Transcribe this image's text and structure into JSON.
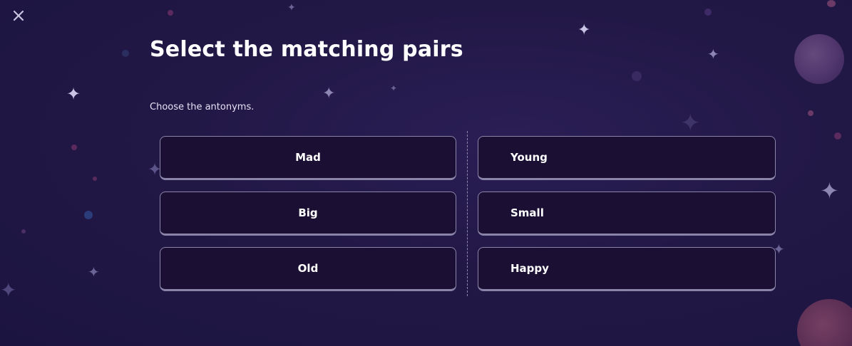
{
  "header": {
    "close_icon": "close-icon"
  },
  "question": {
    "title": "Select the matching pairs",
    "instruction": "Choose the antonyms."
  },
  "pairs": {
    "left": [
      "Mad",
      "Big",
      "Old"
    ],
    "right": [
      "Young",
      "Small",
      "Happy"
    ]
  },
  "colors": {
    "background": "#221846",
    "card_background": "#1b1033",
    "card_border": "#8a84a8",
    "text": "#ffffff"
  }
}
